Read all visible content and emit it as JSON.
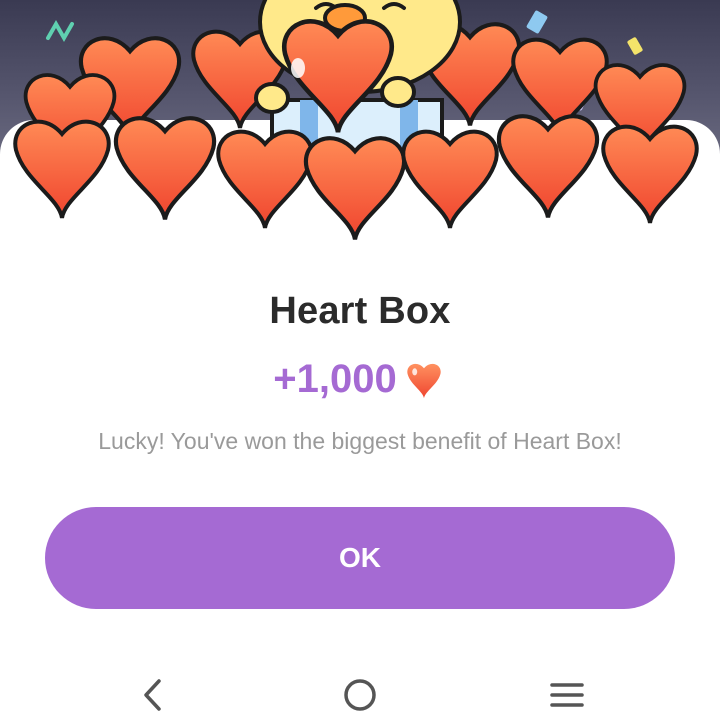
{
  "dialog": {
    "title": "Heart Box",
    "reward_amount": "+1,000",
    "reward_icon": "heart-icon",
    "message": "Lucky! You've won the biggest benefit of Heart Box!",
    "ok_label": "OK"
  },
  "navigation_bar": {
    "back_icon": "back-chevron-icon",
    "home_icon": "home-circle-icon",
    "recents_icon": "recents-menu-icon"
  },
  "colors": {
    "accent": "#a56ad3",
    "title": "#2b2b2b",
    "message": "#9a9a9a",
    "heart": "#f4573a",
    "chick": "#ffe98a"
  }
}
